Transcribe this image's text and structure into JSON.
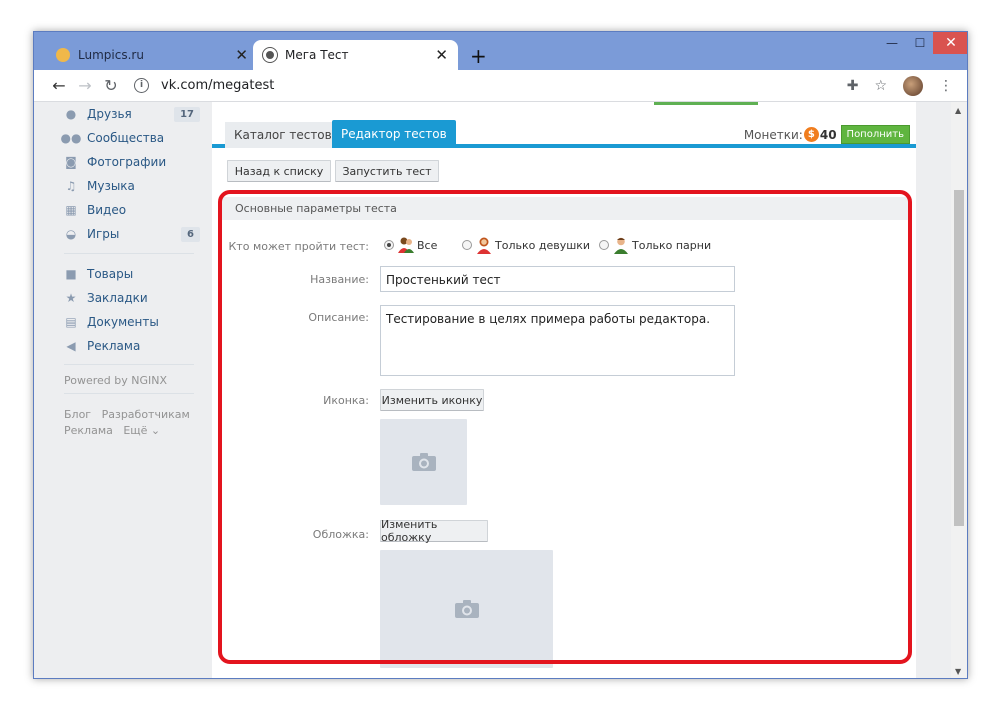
{
  "browser": {
    "tabs": [
      {
        "title": "Lumpics.ru",
        "favicon_color": "#f0b84a"
      },
      {
        "title": "Мега Тест",
        "favicon_color": "#555555"
      }
    ],
    "new_tab": "+",
    "window_controls": {
      "min": "—",
      "max": "☐",
      "close": "✕"
    },
    "url": "vk.com/megatest"
  },
  "sidebar": {
    "items": [
      {
        "label": "Друзья",
        "icon": "person-icon",
        "count": "17"
      },
      {
        "label": "Сообщества",
        "icon": "people-icon"
      },
      {
        "label": "Фотографии",
        "icon": "camera-icon"
      },
      {
        "label": "Музыка",
        "icon": "music-icon"
      },
      {
        "label": "Видео",
        "icon": "film-icon"
      },
      {
        "label": "Игры",
        "icon": "gamepad-icon",
        "count": "6"
      },
      {
        "label": "Товары",
        "icon": "bag-icon"
      },
      {
        "label": "Закладки",
        "icon": "star-icon"
      },
      {
        "label": "Документы",
        "icon": "document-icon"
      },
      {
        "label": "Реклама",
        "icon": "megaphone-icon"
      }
    ],
    "powered": "Powered by NGINX",
    "footer": [
      "Блог",
      "Разработчикам",
      "Реклама",
      "Ещё ⌄"
    ]
  },
  "app": {
    "tabs": [
      "Каталог тестов",
      "Редактор тестов"
    ],
    "coins_label": "Монетки:",
    "coins_value": "40",
    "refill": "Пополнить",
    "back_button": "Назад к списку",
    "run_button": "Запустить тест",
    "section_title": "Основные параметры теста",
    "who_label": "Кто может пройти тест:",
    "who_options": [
      "Все",
      "Только девушки",
      "Только парни"
    ],
    "name_label": "Название:",
    "name_value": "Простенький тест",
    "desc_label": "Описание:",
    "desc_value": "Тестирование в целях примера работы редактора.",
    "icon_label": "Иконка:",
    "change_icon": "Изменить иконку",
    "cover_label": "Обложка:",
    "change_cover": "Изменить обложку"
  },
  "colors": {
    "accent": "#1a9ad3",
    "highlight": "#e3141e",
    "green": "#5fb53f",
    "coin": "#f07d1e"
  }
}
